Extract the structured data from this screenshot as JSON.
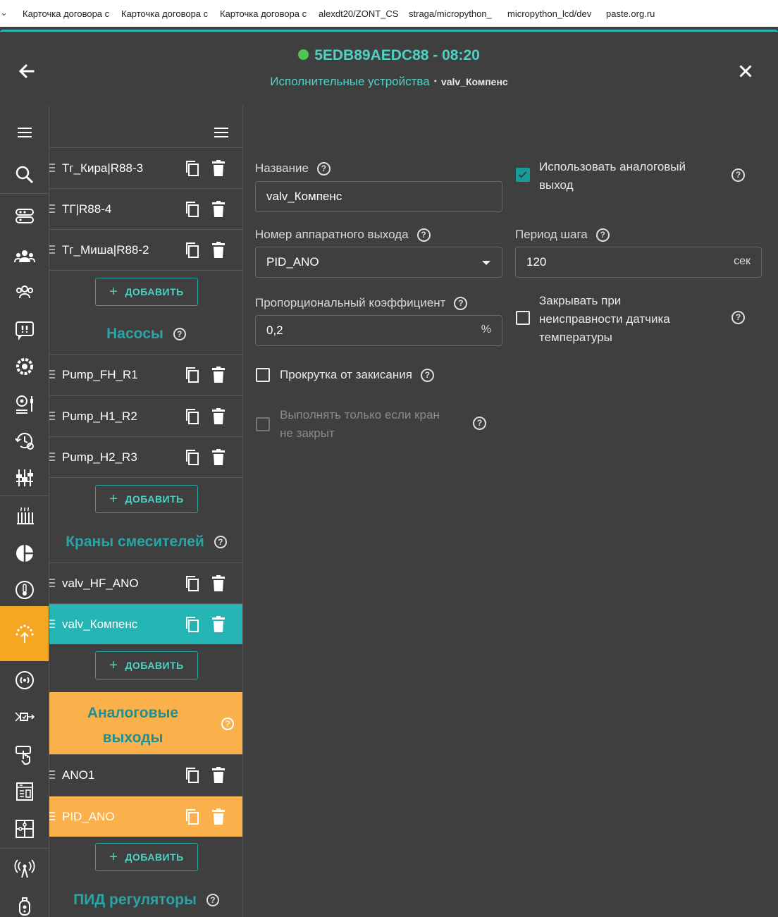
{
  "bookmarks": [
    "Карточка договора с",
    "Карточка договора с",
    "Карточка договора с",
    "alexdt20/ZONT_CS",
    "straga/micropython_",
    "micropython_lcd/dev",
    "paste.org.ru"
  ],
  "header": {
    "device_id": "5EDB89AEDC88",
    "time": " - 08:20",
    "status_color": "#52c452",
    "breadcrumb_parent": "Исполнительные устройства",
    "breadcrumb_sep": "•",
    "breadcrumb_current": "valv_Компенс"
  },
  "rail_icons": [
    "menu-icon",
    "search-icon",
    "controllers-icon",
    "users-icon",
    "groups-icon",
    "messages-icon",
    "automation-icon",
    "settings-icon",
    "schedule-icon",
    "equalizer-icon",
    "heater-icon",
    "zones-icon",
    "thermometer-icon",
    "actuators-icon",
    "radio-icon",
    "inputs-icon",
    "buttons-icon",
    "panel-icon",
    "puzzle-icon",
    "antenna-icon",
    "tag-icon"
  ],
  "list": {
    "top_rows": [
      "Тг_Кира|R88-3",
      "ТГ|R88-4",
      "Тг_Миша|R88-2"
    ],
    "add_label": "ДОБАВИТЬ",
    "section_pumps": "Насосы",
    "pumps": [
      "Pump_FH_R1",
      "Pump_H1_R2",
      "Pump_H2_R3"
    ],
    "section_valves": "Краны смесителей",
    "valves": [
      "valv_HF_ANO",
      "valv_Компенс"
    ],
    "section_analog": [
      "Аналоговые",
      "выходы"
    ],
    "analog": [
      "ANO1",
      "PID_ANO"
    ],
    "section_pid": "ПИД регуляторы",
    "help_glyph": "?"
  },
  "form": {
    "name_label": "Название",
    "name_value": "valv_Компенс",
    "hw_output_label": "Номер аппаратного выхода",
    "hw_output_value": "PID_ANO",
    "prop_coef_label": "Пропорциональный коэффициент",
    "prop_coef_value": "0,2",
    "prop_coef_unit": "%",
    "use_analog_label_1": "Использовать аналоговый",
    "use_analog_label_2": "выход",
    "use_analog_checked": true,
    "step_period_label": "Период шага",
    "step_period_value": "120",
    "step_period_unit": "сек",
    "close_on_fault_label_1": "Закрывать при",
    "close_on_fault_label_2": "неисправности датчика",
    "close_on_fault_label_3": "температуры",
    "anti_stick_label": "Прокрутка от закисания",
    "only_if_open_label_1": "Выполнять только если кран",
    "only_if_open_label_2": "не закрыт"
  }
}
